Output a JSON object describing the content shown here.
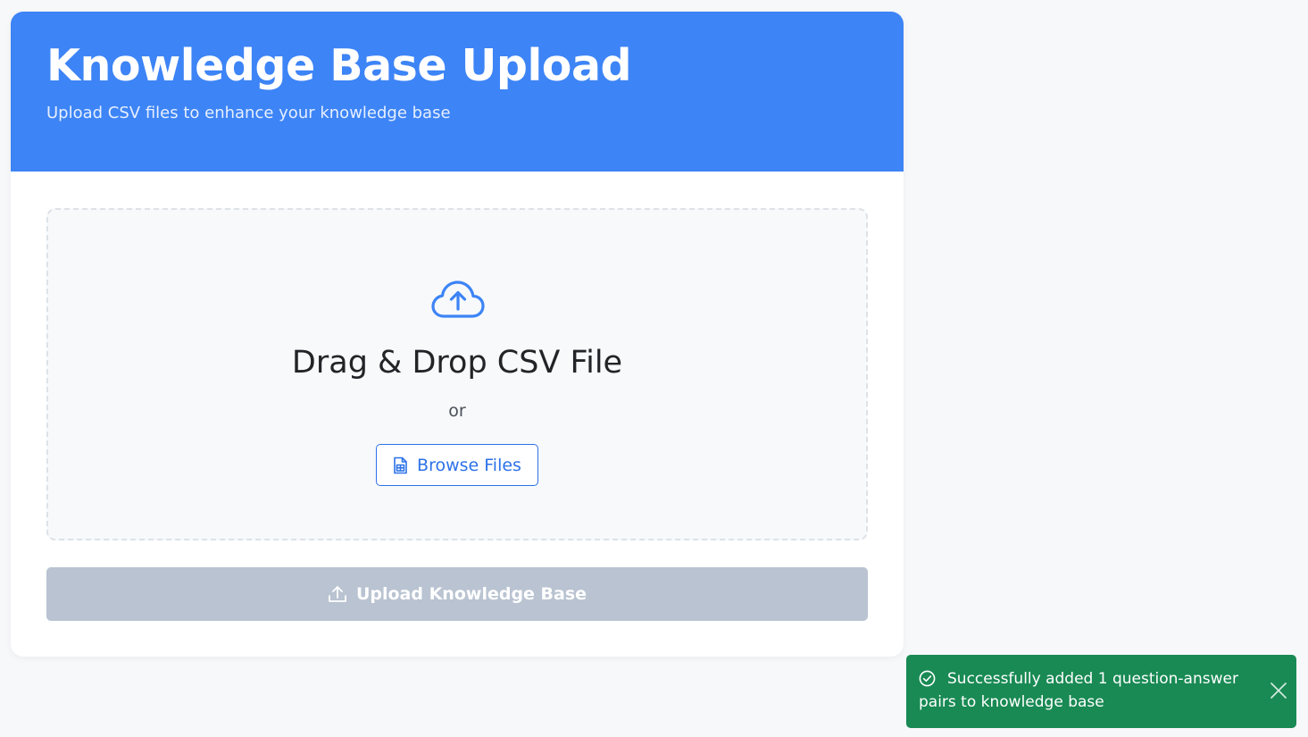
{
  "header": {
    "title": "Knowledge Base Upload",
    "subtitle": "Upload CSV files to enhance your knowledge base"
  },
  "dropzone": {
    "icon": "cloud-upload-icon",
    "title": "Drag & Drop CSV File",
    "separator": "or",
    "browse_label": "Browse Files",
    "browse_icon": "file-spreadsheet-icon"
  },
  "upload_button": {
    "label": "Upload Knowledge Base",
    "icon": "upload-icon",
    "state": "disabled"
  },
  "toast": {
    "message": "Successfully added 1 question-answer pairs to knowledge base",
    "icon": "check-circle-icon",
    "close_icon": "close-icon"
  },
  "colors": {
    "primary": "#3d84f6",
    "link": "#2d72e8",
    "disabled": "#b9c3d1",
    "success": "#198a54",
    "background": "#f7f8fa"
  }
}
